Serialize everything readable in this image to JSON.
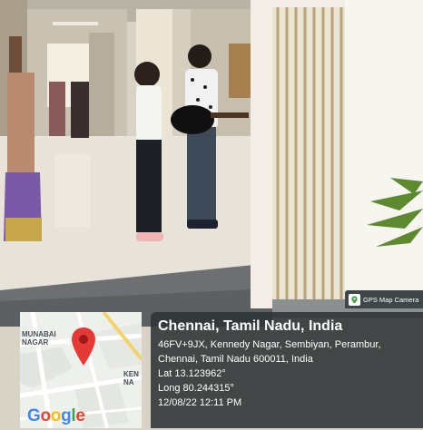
{
  "overlay": {
    "badge": {
      "icon": "map-pin-icon",
      "label": "GPS Map Camera"
    },
    "map": {
      "labels": [
        "MUNABAI",
        "NAGAR",
        "KEN",
        "NA"
      ],
      "logo": "Google",
      "marker": "map-marker-icon",
      "colors": {
        "marker": "#e53935",
        "road": "#ffffff",
        "highway": "#f2d36b"
      }
    },
    "location": {
      "city": "Chennai, Tamil Nadu, India",
      "address_line1": "46FV+9JX, Kennedy Nagar, Sembiyan, Perambur,",
      "address_line2": "Chennai, Tamil Nadu 600011, India",
      "latitude": "Lat 13.123962°",
      "longitude": "Long 80.244315°",
      "timestamp": "12/08/22 12:11 PM"
    },
    "colors": {
      "panel": "#2d3234",
      "text": "#ffffff"
    }
  }
}
